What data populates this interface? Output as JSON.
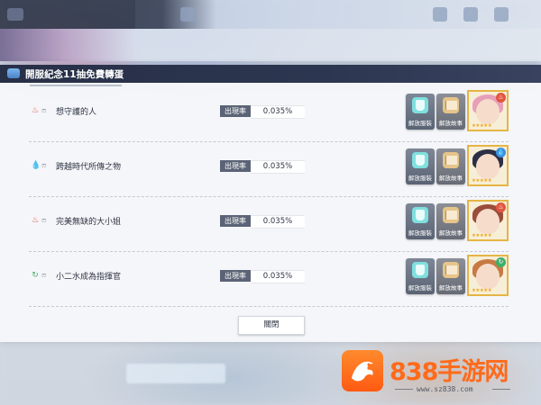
{
  "dialog": {
    "title": "開服紀念11抽免費轉蛋",
    "rate_label": "出現率",
    "buttons": {
      "outfit": "解放服裝",
      "story": "解放故事"
    },
    "close": "關閉"
  },
  "items": [
    {
      "name": "想守護的人",
      "rate": "0.035%",
      "element_icon": "fire-icon",
      "element_color": "#e2553f",
      "rarity_icon": "mask-icon",
      "portrait": {
        "hair": "#e79fb7",
        "tag_color": "#e2553f",
        "stars": "★★★★★"
      }
    },
    {
      "name": "跨越時代所傳之物",
      "rate": "0.035%",
      "element_icon": "water-icon",
      "element_color": "#3d8fe0",
      "rarity_icon": "mask-icon",
      "portrait": {
        "hair": "#2c2f45",
        "tag_color": "#3d8fe0",
        "stars": "★★★★★"
      }
    },
    {
      "name": "完美無缺的大小姐",
      "rate": "0.035%",
      "element_icon": "fire-icon",
      "element_color": "#e2553f",
      "rarity_icon": "mask-icon",
      "portrait": {
        "hair": "#9a4d3a",
        "tag_color": "#e2553f",
        "stars": "★★★★★"
      }
    },
    {
      "name": "小二水成為指揮官",
      "rate": "0.035%",
      "element_icon": "wind-icon",
      "element_color": "#3fae6a",
      "rarity_icon": "mask-icon",
      "portrait": {
        "hair": "#c77a44",
        "tag_color": "#3fae6a",
        "stars": "★★★★★"
      }
    }
  ],
  "watermark": {
    "brand": "838手游网",
    "url": "www.sz838.com"
  }
}
